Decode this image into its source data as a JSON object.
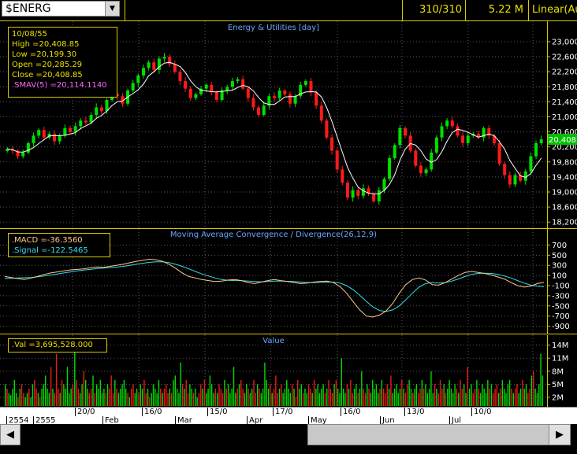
{
  "toolbar": {
    "symbol": "$ENERG",
    "bar_count": "310/310",
    "volume_total": "5.22 M",
    "scale_mode": "Linear(Aut"
  },
  "price_pane": {
    "title": "Energy & Utilities [day]",
    "info": {
      "date": "10/08/55",
      "high": "High  =20,408.85",
      "low": "Low   =20,199.30",
      "open": "Open  =20,285.29",
      "close": "Close =20,408.85",
      "sma": ".SMAV(5)  =20,114.1140"
    },
    "last_value": "20,408",
    "axis_labels": [
      "23,000",
      "22,600",
      "22,200",
      "21,800",
      "21,400",
      "21,000",
      "20,600",
      "20,200",
      "19,800",
      "19,400",
      "19,000",
      "18,600",
      "18,200"
    ],
    "axis_values": [
      23000,
      22600,
      22200,
      21800,
      21400,
      21000,
      20600,
      20200,
      19800,
      19400,
      19000,
      18600,
      18200
    ],
    "ylim": [
      18100,
      23250
    ],
    "colors": {
      "up": "#00e000",
      "down": "#ff1a1a",
      "sma": "#ffffff"
    },
    "closes": [
      20150,
      20100,
      19950,
      20050,
      20300,
      20500,
      20650,
      20450,
      20550,
      20350,
      20500,
      20700,
      20600,
      20750,
      20900,
      20850,
      21050,
      21250,
      21150,
      21450,
      21600,
      21550,
      21350,
      21700,
      21900,
      22100,
      22300,
      22450,
      22250,
      22550,
      22600,
      22400,
      22200,
      21950,
      21750,
      21500,
      21600,
      21750,
      21850,
      21650,
      21450,
      21700,
      21800,
      21950,
      22000,
      21750,
      21500,
      21250,
      21050,
      21300,
      21550,
      21500,
      21700,
      21600,
      21350,
      21550,
      21850,
      21950,
      21650,
      21300,
      20900,
      20450,
      20100,
      19600,
      19250,
      18850,
      19050,
      18900,
      19100,
      18950,
      18750,
      19050,
      19350,
      19900,
      20250,
      20700,
      20500,
      20100,
      19700,
      19500,
      19600,
      20050,
      20450,
      20750,
      20900,
      20750,
      20500,
      20300,
      20500,
      20550,
      20450,
      20700,
      20500,
      20300,
      19750,
      19450,
      19200,
      19450,
      19300,
      19550,
      19950,
      20300,
      20400
    ]
  },
  "macd_pane": {
    "title": "Moving Average Convergence / Divergence(26,12,9)",
    "info": {
      "macd": ".MACD  =-36.3560",
      "signal": ".Signal  =-122.5465"
    },
    "axis_labels": [
      "700",
      "500",
      "300",
      "100",
      "-100",
      "-300",
      "-500",
      "-700",
      "-900"
    ],
    "axis_values": [
      700,
      500,
      300,
      100,
      -100,
      -300,
      -500,
      -700,
      -900
    ],
    "ylim": [
      -1000,
      800
    ],
    "colors": {
      "macd": "#ffc98a",
      "signal": "#33ddee"
    },
    "macd": [
      80,
      60,
      40,
      20,
      50,
      80,
      120,
      150,
      170,
      190,
      210,
      220,
      230,
      250,
      270,
      260,
      280,
      300,
      320,
      350,
      380,
      400,
      420,
      410,
      380,
      320,
      240,
      150,
      80,
      50,
      20,
      0,
      -20,
      -10,
      10,
      20,
      0,
      -40,
      -60,
      -30,
      0,
      20,
      0,
      -20,
      -40,
      -60,
      -50,
      -30,
      -20,
      -10,
      -40,
      -120,
      -250,
      -420,
      -580,
      -700,
      -720,
      -680,
      -600,
      -450,
      -250,
      -80,
      20,
      50,
      10,
      -80,
      -90,
      -40,
      30,
      100,
      160,
      180,
      160,
      140,
      110,
      70,
      30,
      -40,
      -100,
      -130,
      -110,
      -60,
      -36
    ],
    "signal": [
      40,
      45,
      50,
      55,
      60,
      75,
      90,
      110,
      130,
      150,
      170,
      190,
      205,
      220,
      235,
      245,
      255,
      265,
      280,
      300,
      320,
      340,
      360,
      370,
      370,
      355,
      320,
      280,
      230,
      180,
      130,
      90,
      50,
      20,
      5,
      0,
      0,
      -10,
      -20,
      -25,
      -20,
      -10,
      -10,
      -15,
      -20,
      -30,
      -40,
      -40,
      -35,
      -30,
      -30,
      -50,
      -100,
      -180,
      -290,
      -410,
      -520,
      -590,
      -610,
      -580,
      -500,
      -380,
      -250,
      -130,
      -60,
      -40,
      -50,
      -40,
      -10,
      30,
      80,
      120,
      140,
      145,
      140,
      120,
      90,
      50,
      0,
      -50,
      -90,
      -110,
      -122
    ]
  },
  "volume_pane": {
    "title": "Value",
    "info": {
      "value": ".Val  =3,695,528.000"
    },
    "axis_labels": [
      "14M",
      "11M",
      "8M",
      "5M",
      "2M"
    ],
    "axis_values": [
      14,
      11,
      8,
      5,
      2
    ],
    "ylim": [
      0,
      15.2
    ],
    "volumes": [
      5,
      4,
      3,
      2.5,
      4,
      6,
      3,
      2,
      4,
      5,
      3,
      2,
      3,
      4,
      2,
      5,
      6,
      4,
      3,
      2,
      4,
      5,
      7,
      4,
      3,
      9,
      4,
      3,
      12,
      4,
      3,
      6,
      5,
      4,
      9,
      3,
      4,
      5,
      13,
      6,
      4,
      3,
      5,
      8,
      6,
      4,
      3,
      4,
      7,
      3,
      5,
      4,
      6,
      3,
      4,
      3,
      5,
      4,
      7,
      3,
      6,
      4,
      3,
      4,
      5,
      6,
      4,
      3,
      2,
      4,
      5,
      3,
      4,
      3,
      5,
      4,
      6,
      3,
      4,
      2,
      3,
      5,
      4,
      3,
      6,
      4,
      3,
      4,
      5,
      3,
      4,
      3,
      6,
      7,
      4,
      3,
      10,
      5,
      4,
      6,
      3,
      5,
      4,
      3,
      4,
      2,
      3,
      5,
      4,
      6,
      3,
      4,
      7,
      5,
      3,
      4,
      3,
      5,
      4,
      3,
      6,
      4,
      5,
      3,
      4,
      9,
      3,
      4,
      5,
      6,
      4,
      3,
      5,
      4,
      3,
      4,
      6,
      3,
      5,
      4,
      3,
      4,
      10,
      6,
      4,
      5,
      3,
      4,
      7,
      3,
      4,
      5,
      3,
      4,
      6,
      4,
      3,
      5,
      4,
      2,
      6,
      4,
      5,
      3,
      4,
      3,
      5,
      4,
      3,
      6,
      4,
      5,
      3,
      4,
      5,
      3,
      4,
      6,
      4,
      3,
      5,
      6,
      4,
      3,
      11,
      4,
      3,
      5,
      4,
      6,
      3,
      4,
      5,
      3,
      4,
      8,
      4,
      3,
      5,
      4,
      3,
      6,
      4,
      5,
      3,
      4,
      6,
      4,
      3,
      5,
      4,
      7,
      3,
      4,
      5,
      3,
      4,
      6,
      4,
      3,
      5,
      6,
      4,
      3,
      4,
      5,
      3,
      4,
      6,
      4,
      5,
      3,
      4,
      8,
      3,
      5,
      4,
      3,
      6,
      4,
      5,
      3,
      4,
      6,
      4,
      3,
      5,
      4,
      3,
      6,
      4,
      5,
      3,
      9,
      4,
      5,
      3,
      4,
      6,
      4,
      3,
      5,
      4,
      3,
      6,
      4,
      5,
      3,
      4,
      5,
      3,
      4,
      6,
      4,
      3,
      5,
      6,
      4,
      3,
      4,
      5,
      3,
      4,
      6,
      4,
      5,
      3,
      4,
      7,
      8,
      4,
      3,
      5,
      12,
      7
    ]
  },
  "date_axis": {
    "row1": [
      {
        "label": "",
        "x": 8
      },
      {
        "label": "20/0",
        "x": 95
      },
      {
        "label": "16/0",
        "x": 180
      },
      {
        "label": "15/0",
        "x": 263
      },
      {
        "label": "17/0",
        "x": 346
      },
      {
        "label": "16/0",
        "x": 432
      },
      {
        "label": "13/0",
        "x": 513
      },
      {
        "label": "10/0",
        "x": 598
      }
    ],
    "row2": [
      {
        "label": "2554",
        "x": 8
      },
      {
        "label": "2555",
        "x": 42
      },
      {
        "label": "Feb",
        "x": 130
      },
      {
        "label": "Mar",
        "x": 222
      },
      {
        "label": "Apr",
        "x": 313
      },
      {
        "label": "May",
        "x": 391
      },
      {
        "label": "Jun",
        "x": 482
      },
      {
        "label": "Jul",
        "x": 570
      }
    ]
  },
  "scrollbar": {
    "left_arrow": "◀",
    "right_arrow": "▶"
  }
}
